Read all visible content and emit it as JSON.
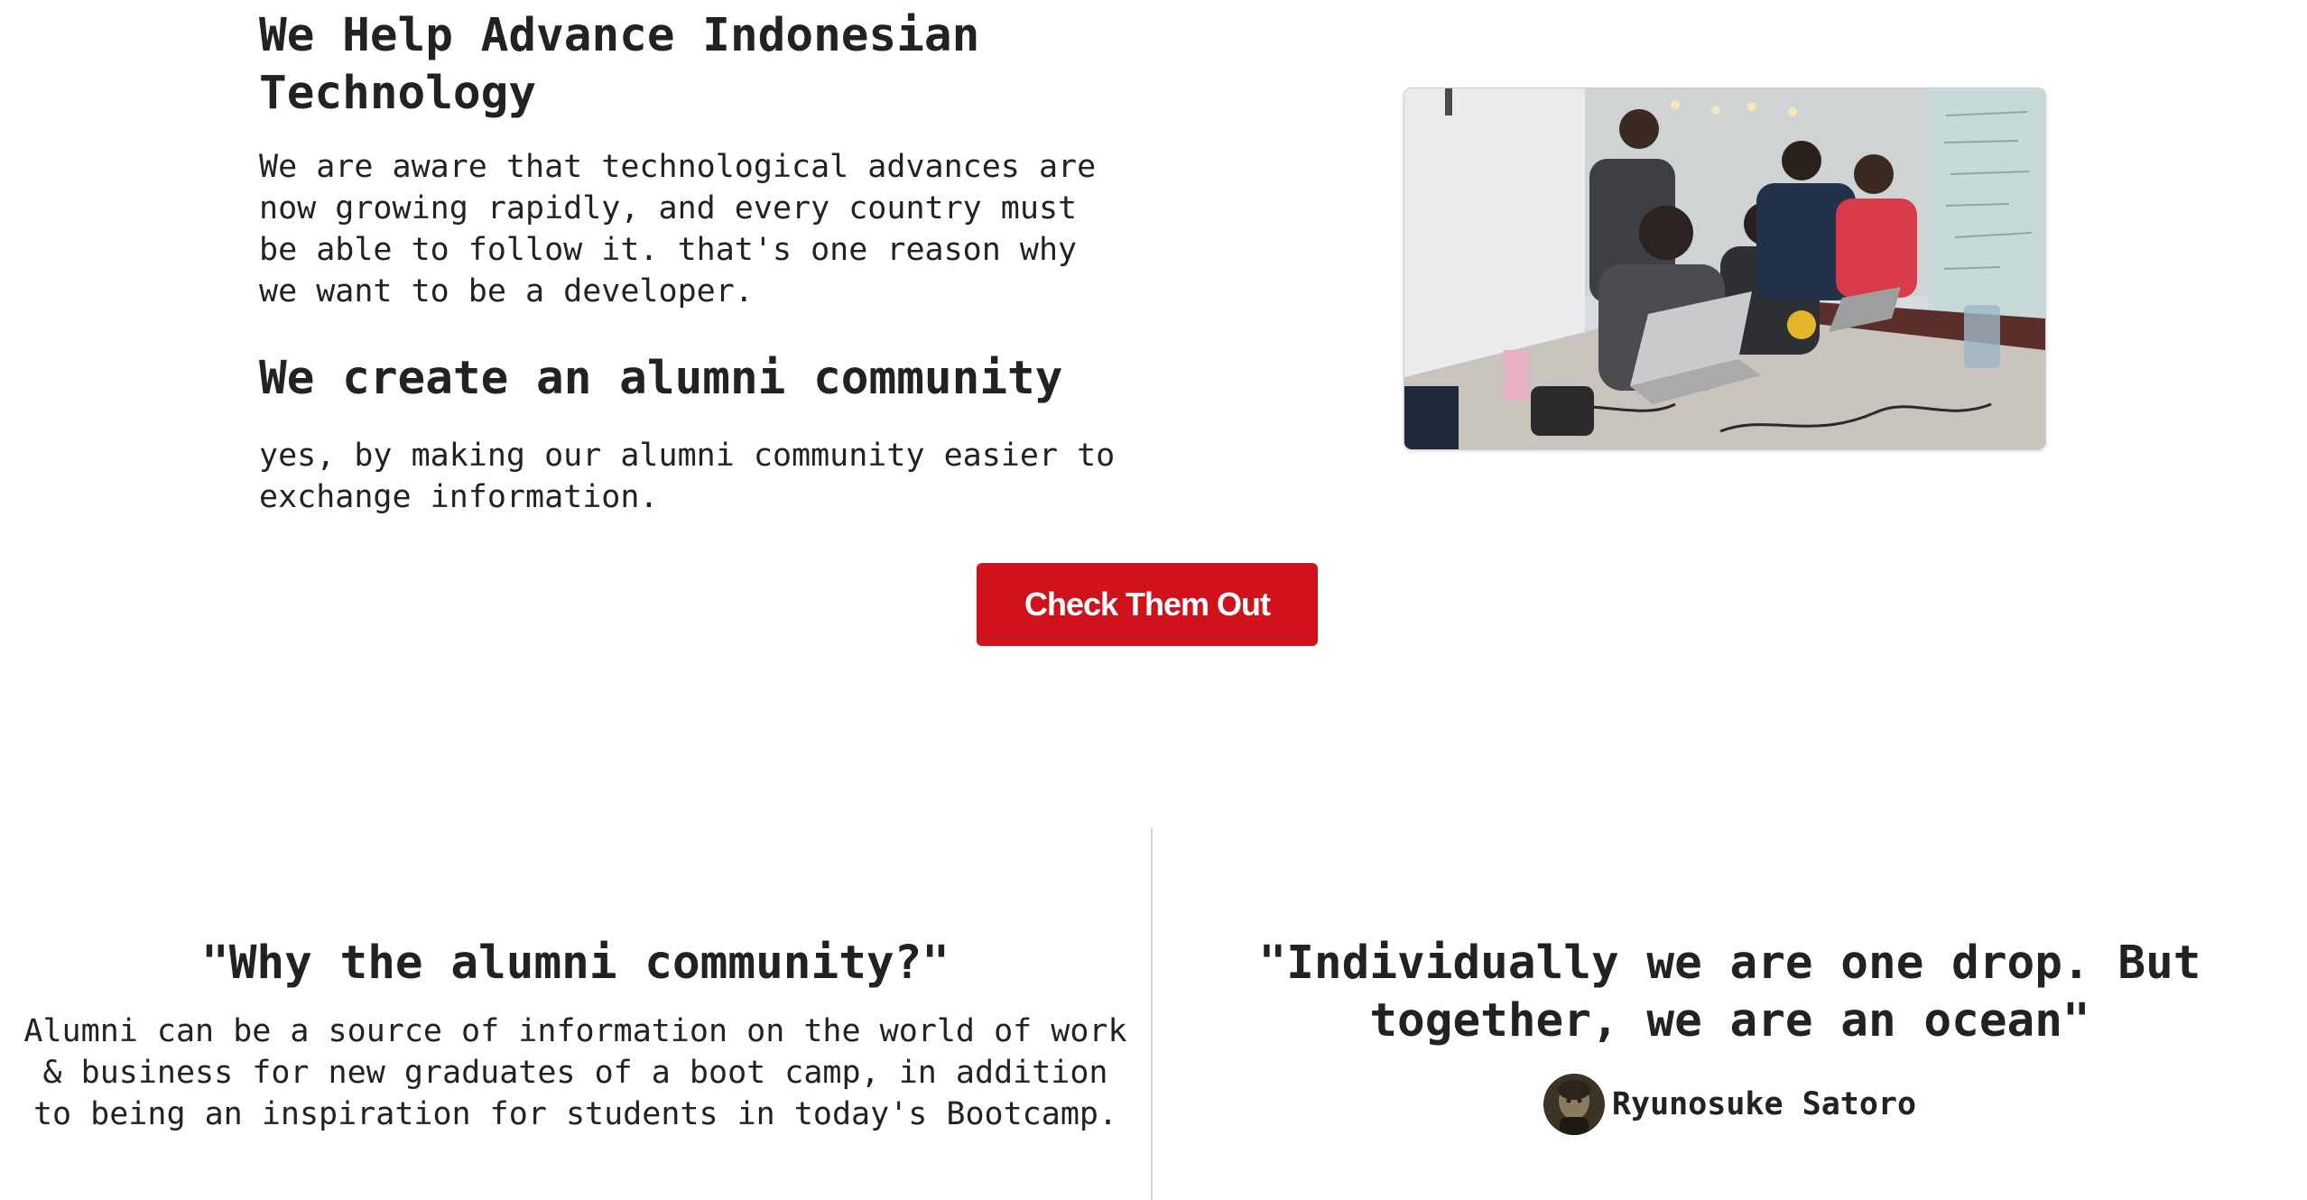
{
  "about": {
    "heading": "We Help Advance Indonesian Technology",
    "paragraph": "We are aware that technological advances are now growing rapidly, and every country must be able to follow it. that's one reason why we want to be a developer.",
    "subheading": "We create an alumni community",
    "subparagraph": "yes, by making our alumni community easier to exchange information.",
    "cta_label": "Check Them Out",
    "photo_icon": "team-photo",
    "accent_color": "#d0121c"
  },
  "why": {
    "title": "\"Why the alumni community?\"",
    "body": "Alumni can be a source of information on the world of work & business for new graduates of a boot camp, in addition to being an inspiration for students in today's Bootcamp."
  },
  "quote": {
    "text": "\"Individually we are one drop. But together, we are an ocean\"",
    "author": "Ryunosuke Satoro",
    "avatar_icon": "avatar-portrait"
  }
}
